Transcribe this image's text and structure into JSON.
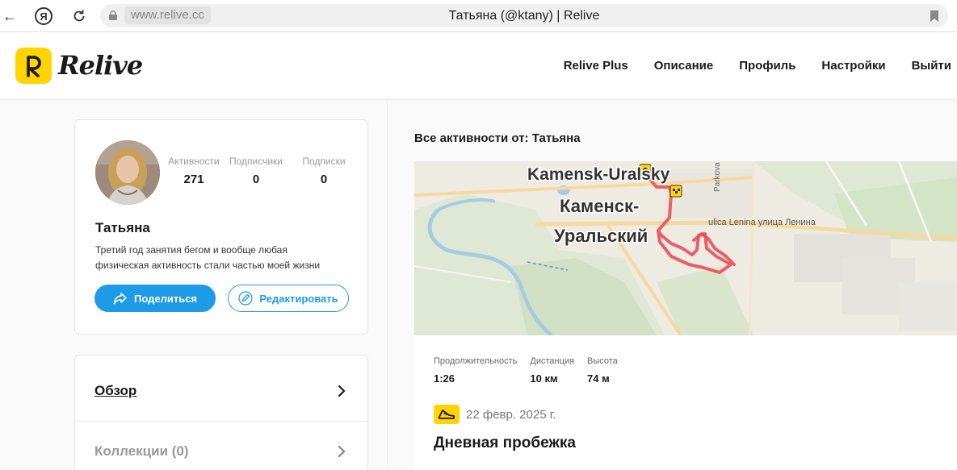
{
  "browser": {
    "back_icon": "←",
    "yandex_icon": "Я",
    "url": "www.relive.cc",
    "tab_title": "Татьяна (@ktany) | Relive"
  },
  "header": {
    "logo_text": "Relive",
    "nav": [
      "Relive Plus",
      "Описание",
      "Профиль",
      "Настройки",
      "Выйти"
    ]
  },
  "profile": {
    "stats": [
      {
        "label": "Активности",
        "value": "271"
      },
      {
        "label": "Подписчики",
        "value": "0"
      },
      {
        "label": "Подписки",
        "value": "0"
      }
    ],
    "name": "Татьяна",
    "bio": "Третий год занятия бегом и вообще любая физическая активность стали частью моей жизни",
    "share_label": "Поделиться",
    "edit_label": "Редактировать"
  },
  "menu": {
    "overview_label": "Обзор",
    "collections_label": "Коллекции (0)"
  },
  "feed": {
    "title": "Все активности от: Татьяна",
    "activity": {
      "map_labels": {
        "city_latin": "Kamensk-Uralsky",
        "city_ru_1": "Каменск-",
        "city_ru_2": "Уральский",
        "street": "ulica Lenina улица Ленина",
        "park": "Parkova"
      },
      "stats": [
        {
          "label": "Продолжительность",
          "value": "1:26"
        },
        {
          "label": "Дистанция",
          "value": "10 км"
        },
        {
          "label": "Высота",
          "value": "74 м"
        }
      ],
      "date": "22 февр. 2025 г.",
      "title": "Дневная пробежка"
    }
  },
  "colors": {
    "brand_yellow": "#ffd400",
    "accent_blue": "#1e9be7",
    "route_red": "#e8505b"
  }
}
